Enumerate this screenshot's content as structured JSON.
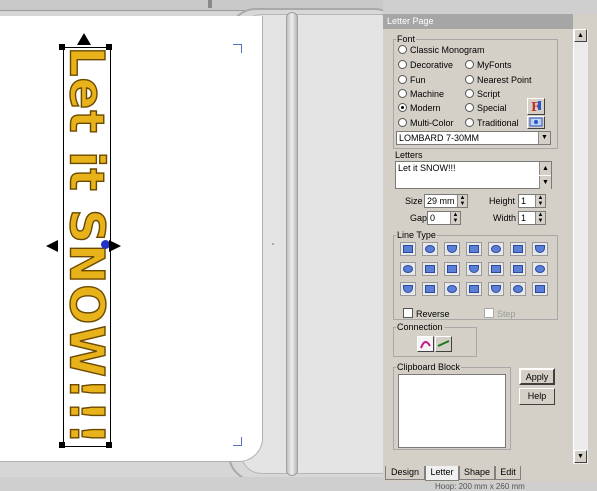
{
  "canvas": {
    "design_text": "Let it SNOW!!!"
  },
  "panel": {
    "title": "Letter Page",
    "font": {
      "legend": "Font",
      "options": [
        {
          "label": "Classic Monogram",
          "selected": false
        },
        {
          "label": "Decorative",
          "selected": false
        },
        {
          "label": "MyFonts",
          "selected": false
        },
        {
          "label": "Fun",
          "selected": false
        },
        {
          "label": "Nearest Point",
          "selected": false
        },
        {
          "label": "Machine",
          "selected": false
        },
        {
          "label": "Script",
          "selected": false
        },
        {
          "label": "Modern",
          "selected": true
        },
        {
          "label": "Special",
          "selected": false
        },
        {
          "label": "Multi-Color",
          "selected": false
        },
        {
          "label": "Traditional",
          "selected": false
        }
      ],
      "selected_font": "LOMBARD 7-30MM"
    },
    "letters": {
      "label": "Letters",
      "value": "Let it SNOW!!!"
    },
    "size": {
      "label": "Size",
      "value": "29 mm"
    },
    "height": {
      "label": "Height",
      "value": "1"
    },
    "gap": {
      "label": "Gap",
      "value": "0"
    },
    "width": {
      "label": "Width",
      "value": "1"
    },
    "line_type": {
      "legend": "Line Type",
      "reverse_label": "Reverse",
      "step_label": "Step"
    },
    "connection": {
      "legend": "Connection"
    },
    "clipboard": {
      "legend": "Clipboard Block",
      "apply_label": "Apply",
      "help_label": "Help"
    },
    "tabs": [
      "Design",
      "Letter",
      "Shape",
      "Edit"
    ],
    "active_tab": "Letter",
    "status_text": "Hoop: 200 mm x 260 mm"
  },
  "colors": {
    "stitch_fill": "#e8b21a",
    "stitch_outline": "#6b4a00",
    "selection_handle": "#000000",
    "panel_bg": "#d4d0c8"
  }
}
